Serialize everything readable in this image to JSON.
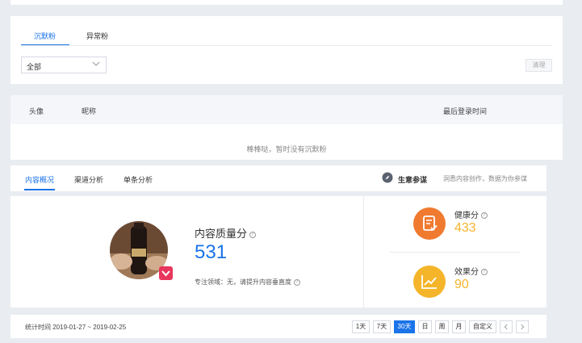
{
  "filter": {
    "tabs": [
      {
        "label": "沉默粉",
        "active": true
      },
      {
        "label": "异常粉",
        "active": false
      }
    ],
    "select_value": "全部",
    "clear_label": "清理"
  },
  "table": {
    "headers": {
      "avatar": "头像",
      "nickname": "昵称",
      "last_login": "最后登录时间"
    },
    "empty_text": "棒棒哒，暂时没有沉默粉"
  },
  "content": {
    "tabs": [
      {
        "label": "内容概况",
        "active": true
      },
      {
        "label": "渠道分析",
        "active": false
      },
      {
        "label": "单条分析",
        "active": false
      }
    ],
    "tip_title": "生意参谋",
    "tip_text": "洞悉内容创作，数据为你参谋",
    "quality_label": "内容质量分",
    "quality_value": "531",
    "domain_text": "专注领域：无，请提升内容垂直度",
    "health_label": "健康分",
    "health_value": "433",
    "effect_label": "效果分",
    "effect_value": "90",
    "period_text": "统计时间 2019-01-27 ~ 2019-02-25",
    "period_buttons": [
      "1天",
      "7天",
      "30天",
      "日",
      "周",
      "月",
      "自定义"
    ],
    "period_active": "30天"
  },
  "colors": {
    "accent": "#1a73e8",
    "health": "#f07a30",
    "effect": "#f5b52a",
    "score_value": "#f5b52a",
    "quality_value": "#1a73e8",
    "badge": "#e8365d"
  }
}
